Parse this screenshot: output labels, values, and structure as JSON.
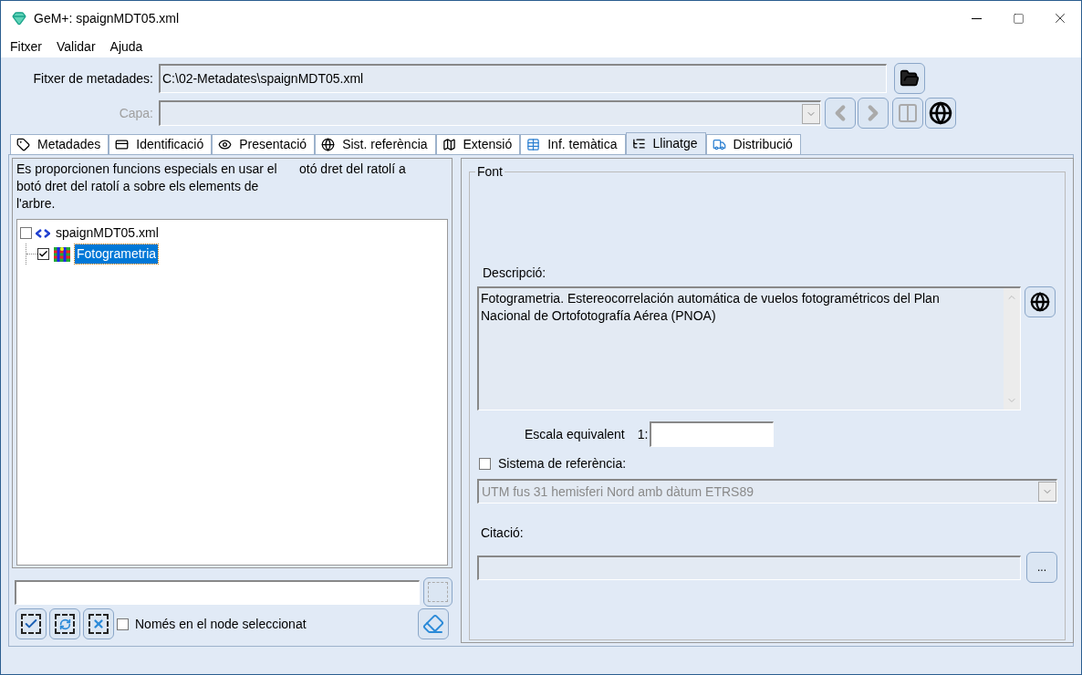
{
  "window": {
    "title": "GeM+: spaignMDT05.xml"
  },
  "menu": [
    "Fitxer",
    "Validar",
    "Ajuda"
  ],
  "metadata_file": {
    "label": "Fitxer de metadades:",
    "value": "C:\\02-Metadates\\spaignMDT05.xml"
  },
  "layer": {
    "label": "Capa:",
    "disabled": true
  },
  "tabs": [
    {
      "label": "Metadades",
      "selected": false
    },
    {
      "label": "Identificació",
      "selected": false
    },
    {
      "label": "Presentació",
      "selected": false
    },
    {
      "label": "Sist. referència",
      "selected": false
    },
    {
      "label": "Extensió",
      "selected": false
    },
    {
      "label": "Inf. temàtica",
      "selected": false
    },
    {
      "label": "Llinatge",
      "selected": true
    },
    {
      "label": "Distribució",
      "selected": false
    }
  ],
  "left_panel": {
    "help_text": "Es proporcionen funcions especials en usar el botó dret del ratolí a sobre els elements de l'arbre.",
    "help_fragment": "otó dret del ratolí a",
    "tree": [
      {
        "label": "spaignMDT05.xml",
        "kind": "xml",
        "checked": false,
        "selected": false,
        "children": [
          {
            "label": "Fotogrametria",
            "kind": "process",
            "checked": true,
            "selected": true
          }
        ]
      }
    ],
    "only_selected_node": {
      "label": "Només en el node seleccionat",
      "checked": false
    }
  },
  "right_panel": {
    "group_title": "Font",
    "description": {
      "label": "Descripció:",
      "value": "Fotogrametria. Estereocorrelación automática de vuelos fotogramétricos del Plan Nacional de Ortofotografía Aérea (PNOA)"
    },
    "scale": {
      "label": "Escala equivalent",
      "prefix": "1:"
    },
    "reference_system": {
      "label": "Sistema de referència:",
      "checked": false,
      "value": "UTM fus 31 hemisferi Nord amb dàtum ETRS89",
      "disabled": true
    },
    "citation": {
      "label": "Citació:",
      "button": "..."
    }
  }
}
